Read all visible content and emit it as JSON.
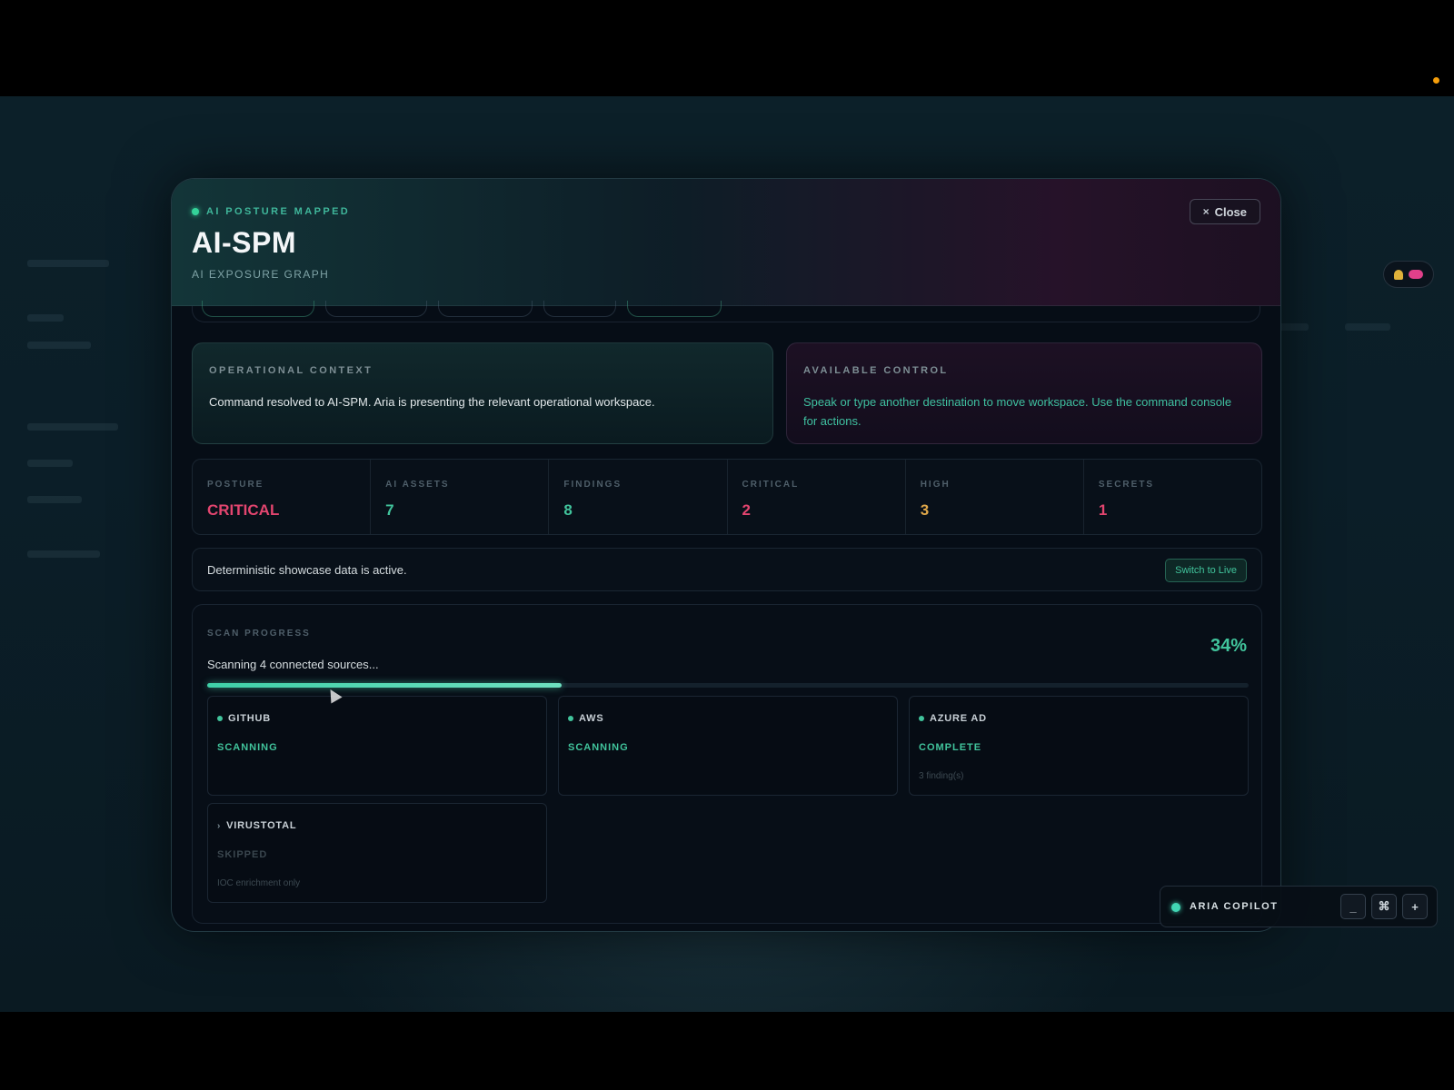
{
  "modal": {
    "status": "AI POSTURE MAPPED",
    "title": "AI-SPM",
    "subtitle": "AI EXPOSURE GRAPH",
    "close_label": "Close",
    "close_icon": "×"
  },
  "cards": {
    "context": {
      "label": "OPERATIONAL CONTEXT",
      "text": "Command resolved to AI-SPM. Aria is presenting the relevant operational workspace."
    },
    "control": {
      "label": "AVAILABLE CONTROL",
      "text": "Speak or type another destination to move workspace. Use the command console for actions."
    }
  },
  "stats": [
    {
      "label": "POSTURE",
      "value": "CRITICAL",
      "color": "#e2456f"
    },
    {
      "label": "AI ASSETS",
      "value": "7",
      "color": "#41c49c"
    },
    {
      "label": "FINDINGS",
      "value": "8",
      "color": "#41c49c"
    },
    {
      "label": "CRITICAL",
      "value": "2",
      "color": "#e2456f"
    },
    {
      "label": "HIGH",
      "value": "3",
      "color": "#e0a84a"
    },
    {
      "label": "SECRETS",
      "value": "1",
      "color": "#e2456f"
    }
  ],
  "banner": {
    "text": "Deterministic showcase data is active.",
    "button_label": "Switch to Live"
  },
  "scan": {
    "label": "SCAN PROGRESS",
    "status": "Scanning 4 connected sources...",
    "percent_label": "34%",
    "progress": 0.34,
    "sources": [
      {
        "name": "GITHUB",
        "state": "SCANNING",
        "note": "",
        "skipped": false
      },
      {
        "name": "AWS",
        "state": "SCANNING",
        "note": "",
        "skipped": false
      },
      {
        "name": "AZURE AD",
        "state": "COMPLETE",
        "note": "3 finding(s)",
        "skipped": false
      },
      {
        "name": "VIRUSTOTAL",
        "state": "SKIPPED",
        "note": "IOC enrichment only",
        "skipped": true
      }
    ]
  },
  "copilot": {
    "label": "ARIA COPILOT",
    "minimize": "_",
    "command": "⌘",
    "add": "+"
  },
  "colors": {
    "accent": "#41c49c",
    "critical": "#e2456f",
    "high": "#e0a84a"
  }
}
